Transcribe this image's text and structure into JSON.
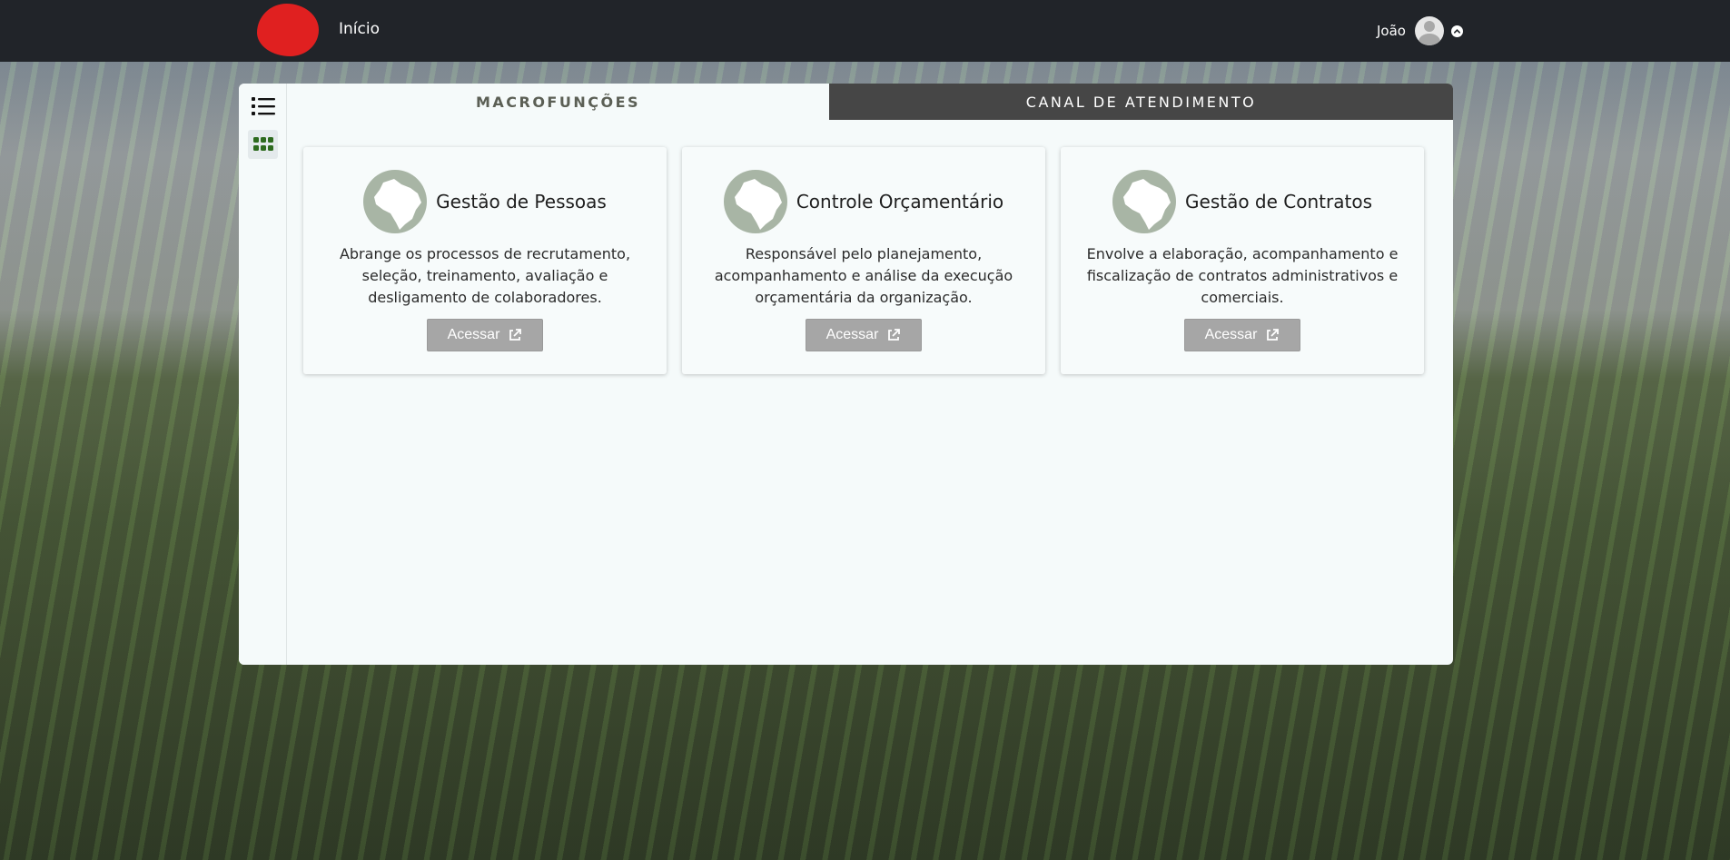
{
  "navbar": {
    "home_label": "Início",
    "user_name": "João"
  },
  "tabs": [
    {
      "label": "MACROFUNÇÕES",
      "active": true
    },
    {
      "label": "CANAL DE ATENDIMENTO",
      "active": false
    }
  ],
  "view_toggle": {
    "list_icon": "list-icon",
    "grid_icon": "grid-icon",
    "active": "grid"
  },
  "cards": [
    {
      "title": "Gestão de Pessoas",
      "description": "Abrange os processos de recrutamento, seleção, treinamento, avaliação e desligamento de colaboradores.",
      "button_label": "Acessar"
    },
    {
      "title": "Controle Orçamentário",
      "description": "Responsável pelo planejamento, acompanhamento e análise da execução orçamentária da organização.",
      "button_label": "Acessar"
    },
    {
      "title": "Gestão de Contratos",
      "description": "Envolve a elaboração, acompanhamento e fiscalização de contratos administrativos e comerciais.",
      "button_label": "Acessar"
    }
  ],
  "colors": {
    "navbar_bg": "#212429",
    "logo": "#e02020",
    "tab_inactive_bg": "#464646",
    "button_bg": "#a6a6a6",
    "icon_circle": "#a8b5a5",
    "grid_icon_active": "#2e6b1f"
  }
}
